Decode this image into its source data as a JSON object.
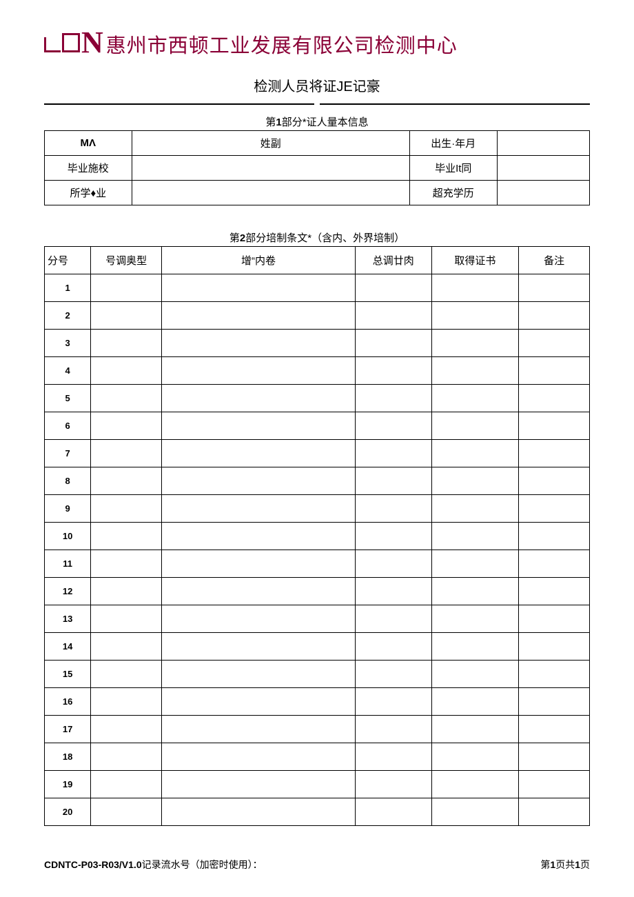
{
  "header": {
    "logo_letter": "N",
    "company_name": "惠州市西顿工业发展有限公司检测中心"
  },
  "page_title": "检测人员将证JE记豪",
  "section1": {
    "title_prefix": "第",
    "title_num": "1",
    "title_suffix": "部分*证人量本信息",
    "rows": [
      {
        "label1": "MΛ",
        "value1": "",
        "label2": "姓副",
        "value2": "",
        "extra_label": "出生·年月",
        "extra_value": ""
      },
      {
        "label1": "毕业施校",
        "value1": "",
        "label2": "毕业It同",
        "value2": ""
      },
      {
        "label1": "所学♦业",
        "value1": "",
        "label2": "超充学历",
        "value2": ""
      }
    ]
  },
  "section2": {
    "title_prefix": "第",
    "title_num": "2",
    "title_suffix": "部分培制条文*（含内、外界培制）",
    "headers": {
      "seq": "分号",
      "type": "号调奥型",
      "content": "增“内卷",
      "total": "总调廿肉",
      "cert": "取得证书",
      "remark": "备注"
    },
    "rows": [
      {
        "n": "1"
      },
      {
        "n": "2"
      },
      {
        "n": "3"
      },
      {
        "n": "4"
      },
      {
        "n": "5"
      },
      {
        "n": "6"
      },
      {
        "n": "7"
      },
      {
        "n": "8"
      },
      {
        "n": "9"
      },
      {
        "n": "10"
      },
      {
        "n": "11"
      },
      {
        "n": "12"
      },
      {
        "n": "13"
      },
      {
        "n": "14"
      },
      {
        "n": "15"
      },
      {
        "n": "16"
      },
      {
        "n": "17"
      },
      {
        "n": "18"
      },
      {
        "n": "19"
      },
      {
        "n": "20"
      }
    ]
  },
  "footer": {
    "code": "CDNTC-P03-R03/V1.0",
    "code_suffix": "记录流水号（加密时使用）：",
    "page_prefix": "第",
    "page_current": "1",
    "page_mid": "页共",
    "page_total": "1",
    "page_suffix": "页"
  }
}
